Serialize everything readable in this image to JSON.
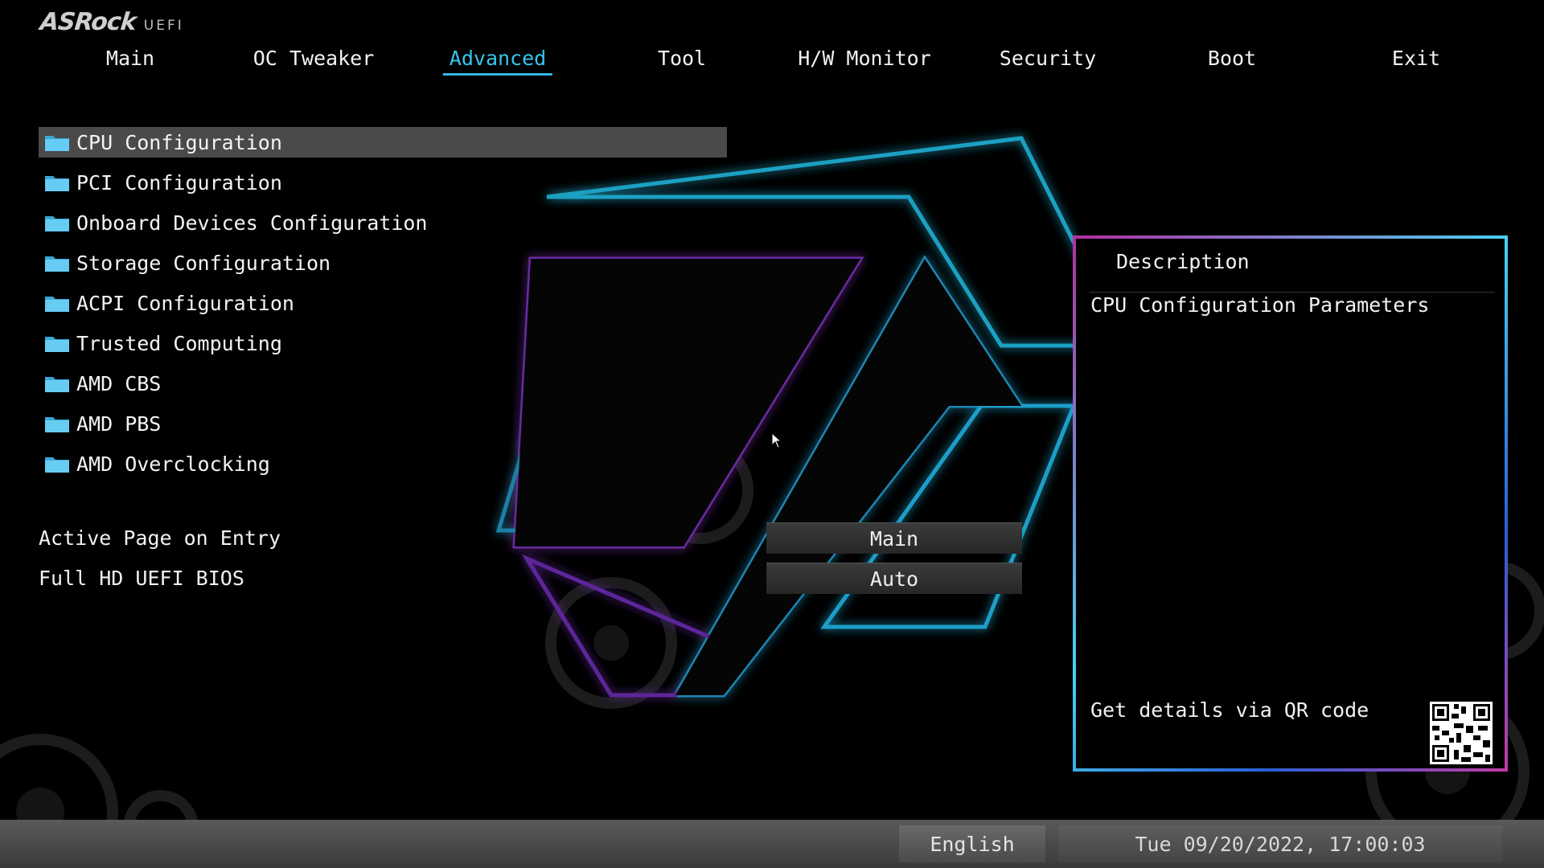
{
  "brand": {
    "logo": "ASRock",
    "suffix": "UEFI"
  },
  "nav": {
    "tabs": [
      {
        "label": "Main"
      },
      {
        "label": "OC Tweaker"
      },
      {
        "label": "Advanced",
        "active": true
      },
      {
        "label": "Tool"
      },
      {
        "label": "H/W Monitor"
      },
      {
        "label": "Security"
      },
      {
        "label": "Boot"
      },
      {
        "label": "Exit"
      }
    ]
  },
  "menu": {
    "items": [
      {
        "label": "CPU Configuration",
        "icon": "folder-icon",
        "selected": true
      },
      {
        "label": "PCI Configuration",
        "icon": "folder-icon"
      },
      {
        "label": "Onboard Devices Configuration",
        "icon": "folder-icon"
      },
      {
        "label": "Storage Configuration",
        "icon": "folder-icon"
      },
      {
        "label": "ACPI Configuration",
        "icon": "folder-icon"
      },
      {
        "label": "Trusted Computing",
        "icon": "folder-icon"
      },
      {
        "label": "AMD CBS",
        "icon": "folder-icon"
      },
      {
        "label": "AMD PBS",
        "icon": "folder-icon"
      },
      {
        "label": "AMD Overclocking",
        "icon": "folder-icon"
      }
    ]
  },
  "settings": {
    "active_page_label": "Active Page on Entry",
    "active_page_value": "Main",
    "full_hd_label": "Full HD UEFI BIOS",
    "full_hd_value": "Auto"
  },
  "description": {
    "title": "Description",
    "text": "CPU Configuration Parameters",
    "qr_label": "Get details via QR code"
  },
  "footer": {
    "language": "English",
    "datetime": "Tue 09/20/2022, 17:00:03"
  },
  "colors": {
    "accent": "#35c6ec",
    "folder": "#5fc8f2",
    "selected_bg": "#4a4a4a"
  }
}
